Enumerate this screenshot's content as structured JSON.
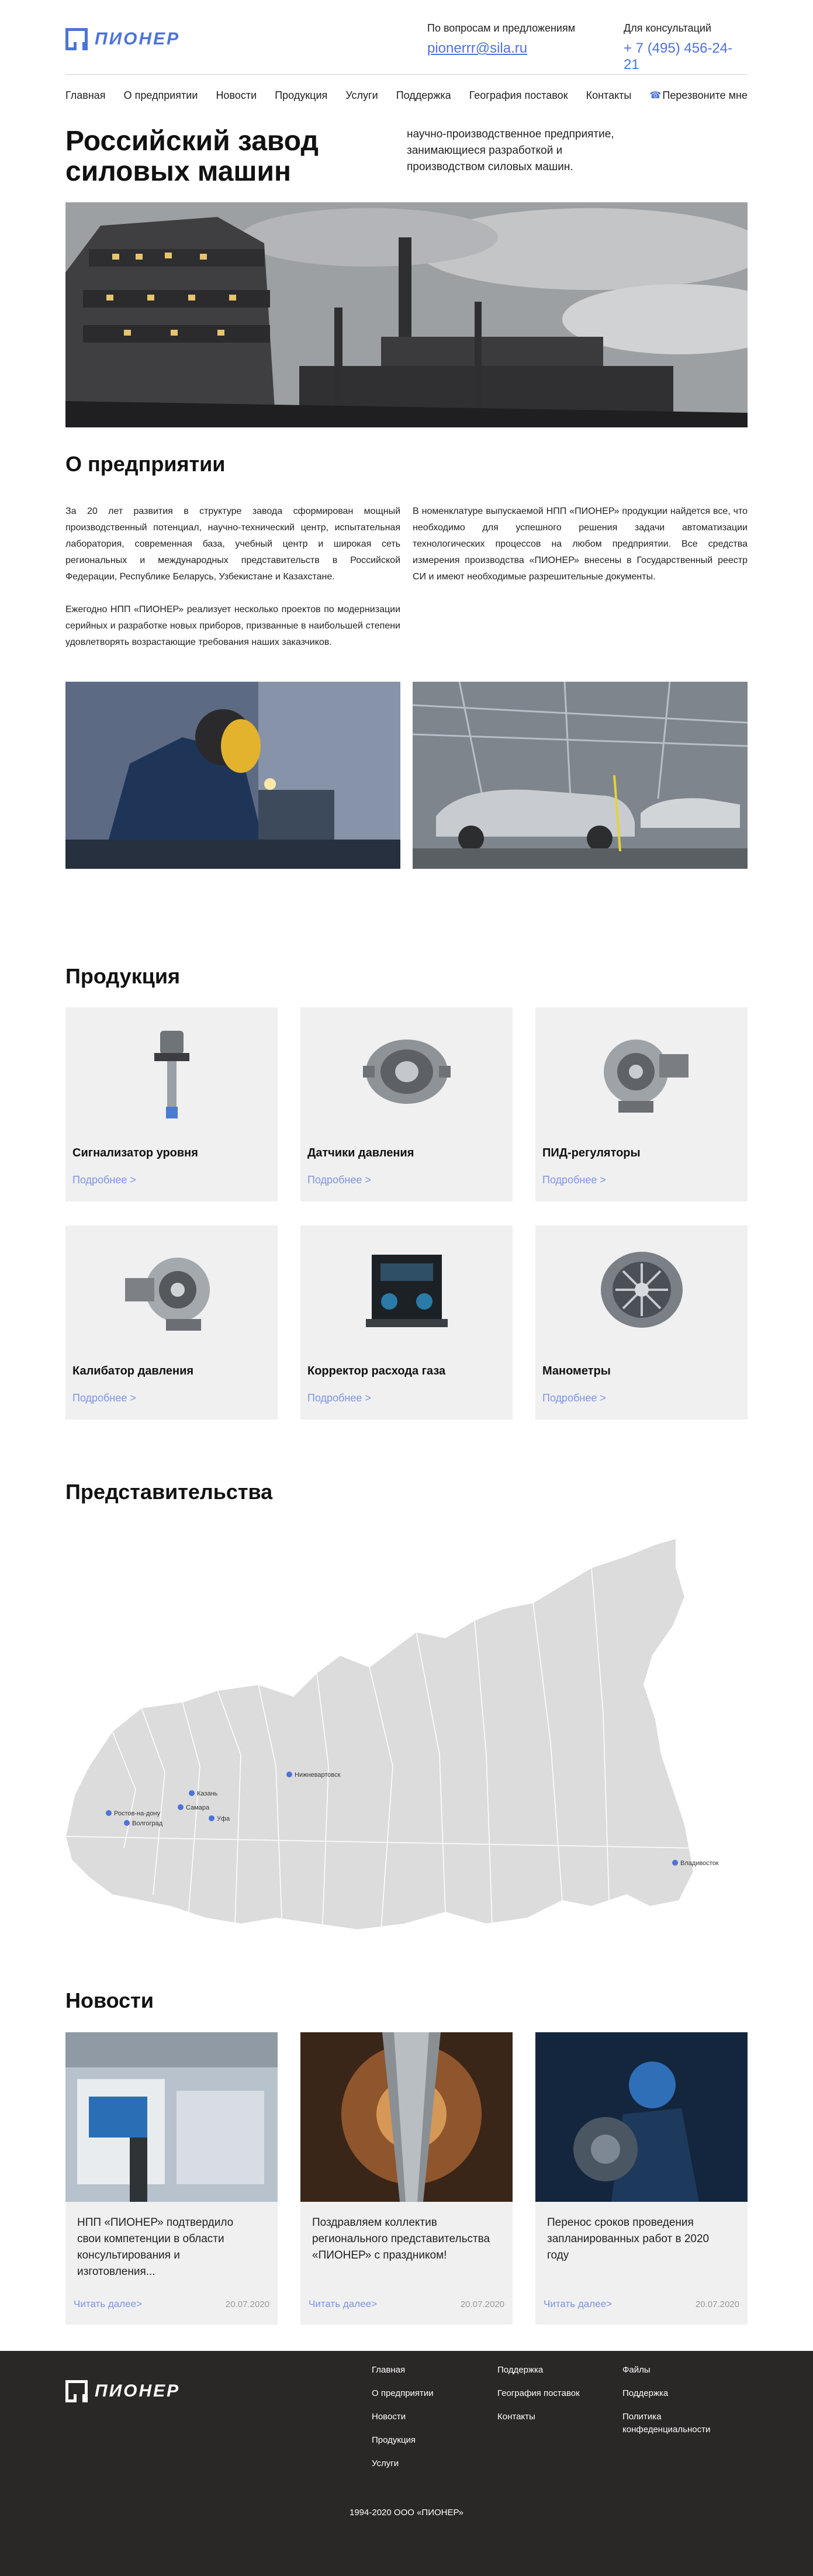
{
  "brand": {
    "name": "ПИОНЕР",
    "accent": "#4d73d8",
    "link_color": "#7d93e0"
  },
  "header": {
    "questions_label": "По вопросам и предложениям",
    "email": "pionerrr@sila.ru",
    "consult_label": "Для консультаций",
    "phone": "+ 7 (495) 456-24-21"
  },
  "nav": {
    "items": [
      "Главная",
      "О предприятии",
      "Новости",
      "Продукция",
      "Услуги",
      "Поддержка",
      "География поставок",
      "Контакты"
    ],
    "callback": "Перезвоните мне",
    "callback_icon": "phone-icon"
  },
  "hero": {
    "title_line1": "Российский завод",
    "title_line2": "силовых машин",
    "description": "научно-производственное предприятие, занимающиеся разработкой и производством силовых машин."
  },
  "about": {
    "title": "О предприятии",
    "left_p1": "За 20 лет развития в структуре завода сформирован мощный производственный потенциал, научно-технический центр, испытательная лаборатория, современная база, учебный центр и широкая сеть региональных и международных представительств в Российской Федерации, Республике Беларусь, Узбекистане и Казахстане.",
    "left_p2": "Ежегодно НПП «ПИОНЕР» реализует несколько проектов по модернизации серийных и разработке новых приборов, призванные в наибольшей степени удовлетворять возрастающие требования наших заказчиков.",
    "right_p1": "В номенклатуре выпускаемой НПП «ПИОНЕР» продукции найдется все, что необходимо для успешного решения задачи автоматизации технологических процессов на любом предприятии. Все средства измерения производства «ПИОНЕР» внесены в Государственный реестр СИ и имеют необходимые разрешительные документы."
  },
  "products": {
    "title": "Продукция",
    "more_label": "Подробнее >",
    "items": [
      {
        "name": "Сигнализатор уровня",
        "icon": "level-sensor-icon"
      },
      {
        "name": "Датчики давления",
        "icon": "pressure-sensor-icon"
      },
      {
        "name": "ПИД-регуляторы",
        "icon": "turbocharger-icon"
      },
      {
        "name": "Калибатор давления",
        "icon": "turbocharger-icon"
      },
      {
        "name": "Корректор расхода газа",
        "icon": "engine-icon"
      },
      {
        "name": "Манометры",
        "icon": "turbine-icon"
      }
    ]
  },
  "representations": {
    "title": "Представительства",
    "cities": [
      "Нижневартовск",
      "Казань",
      "Самара",
      "Уфа",
      "Ростов-на-дону",
      "Волгоград",
      "Владивосток"
    ],
    "map_fill": "#dcdcdc",
    "marker_color": "#4d73d8"
  },
  "news": {
    "title": "Новости",
    "more_label": "Читать далее>",
    "items": [
      {
        "text": "НПП «ПИОНЕР» подтвердило свои компетенции в области консультирования и изготовления...",
        "date": "20.07.2020"
      },
      {
        "text": "Поздравляем коллектив регионального представительства «ПИОНЕР» с праздником!",
        "date": "20.07.2020"
      },
      {
        "text": "Перенос сроков проведения запланированных работ в 2020 году",
        "date": "20.07.2020"
      }
    ]
  },
  "footer": {
    "col1": [
      "Главная",
      "О предприятии",
      "Новости",
      "Продукция",
      "Услуги"
    ],
    "col2": [
      "Поддержка",
      "География поставок",
      "Контакты"
    ],
    "col3": [
      "Файлы",
      "Поддержка",
      "Политика конфеденциальности"
    ],
    "copyright": "1994-2020 ООО «ПИОНЕР»"
  }
}
